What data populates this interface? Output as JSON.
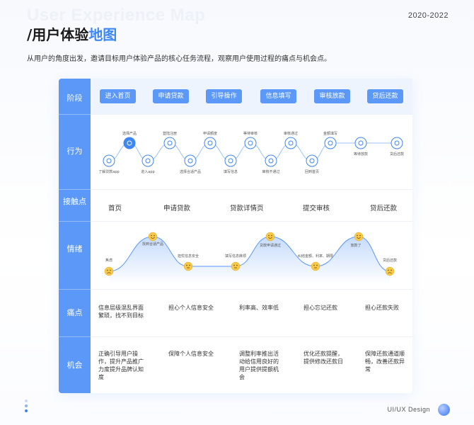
{
  "header": {
    "bg_title": "User Experience Map",
    "title_prefix": "/用户体验",
    "title_highlight": "地图",
    "year": "2020-2022",
    "subtitle": "从用户的角度出发，邀请目标用户体验产品的核心任务流程，观察用户使用过程的痛点与机会点。"
  },
  "rows": {
    "stage": "阶段",
    "behavior": "行为",
    "touchpoint": "接触点",
    "emotion": "情绪",
    "pain": "痛点",
    "opportunity": "机会"
  },
  "stages": [
    "进入首页",
    "申请贷款",
    "引导操作",
    "信息填写",
    "审核放款",
    "贷后还款"
  ],
  "behaviors": [
    {
      "label": "了解贷款app",
      "icon": "share-icon"
    },
    {
      "label": "选择产品",
      "icon": "heart-icon"
    },
    {
      "label": "进入app",
      "icon": "arrow-icon"
    },
    {
      "label": "登陆注册",
      "icon": "document-icon"
    },
    {
      "label": "选择合适产品",
      "icon": "cloud-icon"
    },
    {
      "label": "申请额度",
      "icon": "edit-icon"
    },
    {
      "label": "填写信息",
      "icon": "form-icon"
    },
    {
      "label": "等待审核",
      "icon": "sun-icon"
    },
    {
      "label": "审核不通过",
      "icon": "close-icon"
    },
    {
      "label": "审核通过",
      "icon": "bulb-icon"
    },
    {
      "label": "回到首页",
      "icon": "loop-icon"
    },
    {
      "label": "金额填写",
      "icon": "pen-icon"
    },
    {
      "label": "等待放款",
      "icon": "download-icon"
    },
    {
      "label": "贷后还款",
      "icon": "copy-icon"
    }
  ],
  "touchpoints": [
    "首页",
    "申请贷款",
    "贷款详情页",
    "提交审核",
    "贷后还款"
  ],
  "emotions": [
    {
      "label": "焦虑",
      "mood": "sad"
    },
    {
      "label": "找到合适产品",
      "mood": "happy"
    },
    {
      "label": "担忧信息安全",
      "mood": "neutral"
    },
    {
      "label": "填写信息麻烦",
      "mood": "neutral"
    },
    {
      "label": "贷款申请通过",
      "mood": "happy"
    },
    {
      "label": "纠结金额、利率、期限",
      "mood": "neutral"
    },
    {
      "label": "放款了",
      "mood": "happy"
    },
    {
      "label": "贷后还款",
      "mood": "sad"
    }
  ],
  "pain_points": [
    "信息层级混乱界面繁琐，找不到目标",
    "担心个人信息安全",
    "利率高、效率低",
    "担心忘记还款",
    "担心还款失败"
  ],
  "opportunities": [
    "正确引导用户操作，提升产品推广力度提升品牌认知度",
    "保障个人信息安全",
    "调整利率推出活动给信用良好的用户提供提额机会",
    "优化还款提醒，提供修改还款日",
    "保障还款通道顺畅，改善还款异常"
  ],
  "footer": {
    "tag": "UI/UX Design"
  },
  "colors": {
    "accent": "#5b98f8",
    "band": "#eef4fd"
  }
}
